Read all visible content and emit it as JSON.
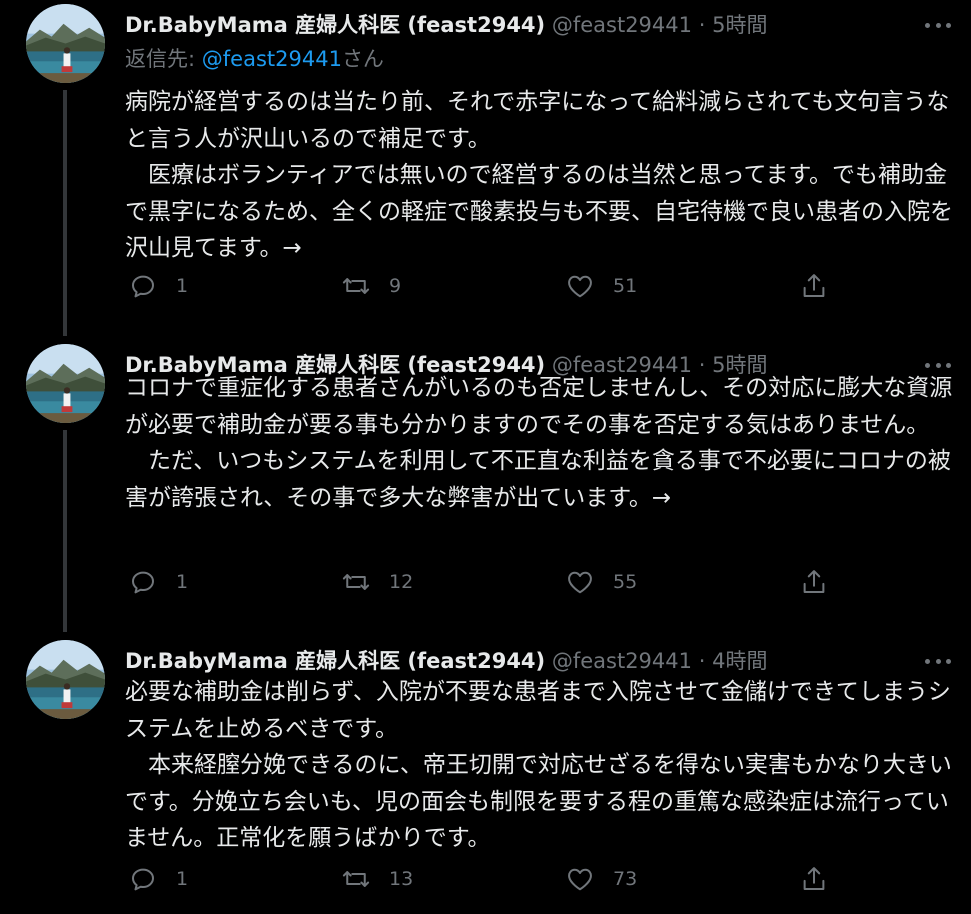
{
  "author": {
    "display_name": "Dr.BabyMama 産婦人科医 (feast2944)",
    "handle": "@feast29441"
  },
  "tweets": [
    {
      "time": "5時間",
      "reply_to_prefix": "返信先: ",
      "reply_to_handle": "@feast29441",
      "reply_to_suffix": "さん",
      "text": "病院が経営するのは当たり前、それで赤字になって給料減らされても文句言うなと言う人が沢山いるので補足です。\n　医療はボランティアでは無いので経営するのは当然と思ってます。でも補助金で黒字になるため、全くの軽症で酸素投与も不要、自宅待機で良い患者の入院を沢山見てます。→",
      "replies": "1",
      "retweets": "9",
      "likes": "51"
    },
    {
      "time": "5時間",
      "text": "コロナで重症化する患者さんがいるのも否定しませんし、その対応に膨大な資源が必要で補助金が要る事も分かりますのでその事を否定する気はありません。\n　ただ、いつもシステムを利用して不正直な利益を貪る事で不必要にコロナの被害が誇張され、その事で多大な弊害が出ています。→",
      "replies": "1",
      "retweets": "12",
      "likes": "55"
    },
    {
      "time": "4時間",
      "text": "必要な補助金は削らず、入院が不要な患者まで入院させて金儲けできてしまうシステムを止めるべきです。\n　本来経膣分娩できるのに、帝王切開で対応せざるを得ない実害もかなり大きいです。分娩立ち会いも、児の面会も制限を要する程の重篤な感染症は流行っていません。正常化を願うばかりです。",
      "replies": "1",
      "retweets": "13",
      "likes": "73"
    }
  ],
  "separator": "·",
  "icons": {
    "reply": "reply-icon",
    "retweet": "retweet-icon",
    "like": "heart-icon",
    "share": "share-icon",
    "more": "more-icon",
    "avatar": "avatar-landscape-photo"
  },
  "colors": {
    "background": "#000000",
    "text": "#e7e9ea",
    "secondary": "#71767b",
    "link": "#1d9bf0",
    "thread_line": "#333639"
  }
}
